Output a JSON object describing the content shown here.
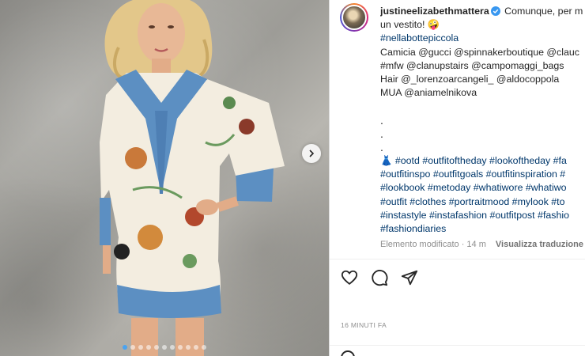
{
  "post": {
    "username": "justineelizabethmattera",
    "caption_intro": "Comunque, per m",
    "caption_line2": "un vestito! 🤪",
    "hashtag_main": "#nellabottepiccola",
    "credits": [
      "Camicia @gucci @spinnakerboutique @clauc",
      "#mfw @clanupstairs @campomaggi_bags",
      "Hair @_lorenzoarcangeli_ @aldocoppola",
      "MUA @aniamelnikova"
    ],
    "dots": [
      ".",
      ".",
      "."
    ],
    "hashtags": [
      "👗 #ootd #outfitoftheday #lookoftheday #fa",
      "#outfitinspo #outfitgoals #outfitinspiration #",
      "#lookbook #metoday #whatiwore #whatiwo",
      "#outfit #clothes #portraitmood #mylook #to",
      "#instastyle #instafashion #outfitpost #fashio",
      "#fashiondiaries"
    ],
    "edited_label": "Elemento modificato · 14 m",
    "translate_label": "Visualizza traduzione",
    "timestamp": "16 MINUTI FA"
  },
  "icons": {
    "verified": "verified-badge-icon",
    "like": "heart-icon",
    "comment": "comment-icon",
    "share": "paper-plane-icon",
    "next": "chevron-right-icon"
  },
  "colors": {
    "verified": "#3897f0",
    "link": "#00376b",
    "muted": "#8e8e8e",
    "active_dot": "#4aa3f0"
  },
  "carousel": {
    "slide_count": 11,
    "active_index": 0
  }
}
